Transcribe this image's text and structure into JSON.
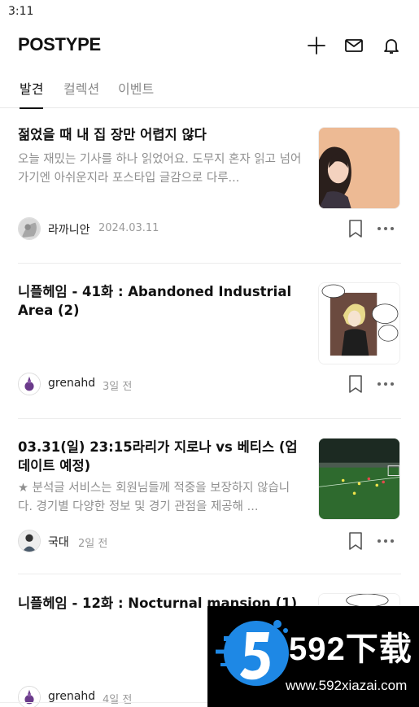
{
  "status_bar": {
    "time": "3:11"
  },
  "header": {
    "logo": "POSTYPE",
    "icons": [
      "plus-icon",
      "mail-icon",
      "bell-icon"
    ]
  },
  "tabs": [
    {
      "label": "발견",
      "active": true
    },
    {
      "label": "컬렉션",
      "active": false
    },
    {
      "label": "이벤트",
      "active": false
    }
  ],
  "posts": [
    {
      "title": "젊었을 때 내 집 장만 어렵지 않다",
      "excerpt": "오늘 재밌는 기사를 하나 읽었어요.  도무지 혼자 읽고 넘어가기엔 아쉬운지라 포스타입 글감으로 다루...",
      "author": "라까니안",
      "date": "2024.03.11"
    },
    {
      "title": "니플헤임 - 41화 : Abandoned Industrial Area (2)",
      "excerpt": "",
      "author": "grenahd",
      "date": "3일 전"
    },
    {
      "title": "03.31(일) 23:15라리가 지로나 vs 베티스 (업데이트 예정)",
      "excerpt": "★ 분석글 서비스는 회원님들께 적중을 보장하지 않습니다. 경기별 다양한 정보 및 경기 관점을 제공해 ...",
      "author": "국대",
      "date": "2일 전"
    },
    {
      "title": "니플헤임 - 12화 : Nocturnal mansion (1)",
      "excerpt": "",
      "author": "grenahd",
      "date": "4일 전"
    }
  ],
  "watermark": {
    "brand": "592下载",
    "url": "www.592xiazai.com"
  },
  "colors": {
    "text": "#111111",
    "muted": "#8f8f8f",
    "divider": "#ececec"
  }
}
